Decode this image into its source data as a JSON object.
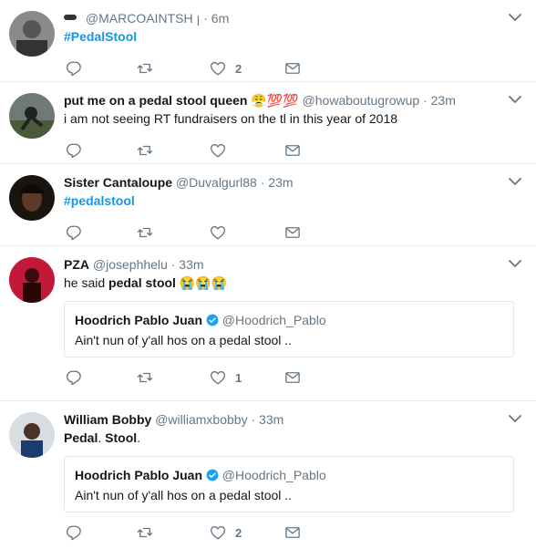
{
  "tweets": [
    {
      "name": "",
      "handle": "@MARCOAINTSH",
      "time": "6m",
      "text_parts": [
        "#PedalStool"
      ],
      "likes": "2",
      "retweets": "",
      "replies": ""
    },
    {
      "name": "put me on a pedal stool queen",
      "name_emoji": "😤💯💯",
      "handle": "@howaboutugrowup",
      "time": "23m",
      "text": "i am not seeing RT fundraisers on the tl in this year of 2018",
      "likes": "",
      "retweets": "",
      "replies": ""
    },
    {
      "name": "Sister Cantaloupe",
      "handle": "@Duvalgurl88",
      "time": "23m",
      "text": "#pedalstool",
      "likes": "",
      "retweets": "",
      "replies": ""
    },
    {
      "name": "PZA",
      "handle": "@josephhelu",
      "time": "33m",
      "text_prefix": "he said ",
      "text_bold": "pedal stool",
      "text_emoji": " 😭😭😭",
      "quote": {
        "name": "Hoodrich Pablo Juan",
        "handle": "@Hoodrich_Pablo",
        "text": "Ain't nun of y'all hos on a pedal stool .."
      },
      "likes": "1",
      "retweets": "",
      "replies": ""
    },
    {
      "name": "William Bobby",
      "handle": "@williamxbobby",
      "time": "33m",
      "text_bold1": "Pedal",
      "text_mid": ". ",
      "text_bold2": "Stool",
      "text_end": ".",
      "quote": {
        "name": "Hoodrich Pablo Juan",
        "handle": "@Hoodrich_Pablo",
        "text": "Ain't nun of y'all hos on a pedal stool .."
      },
      "likes": "2",
      "retweets": "",
      "replies": ""
    }
  ],
  "separator": "·",
  "colors": {
    "hashtag": "#1b95e0",
    "secondary": "#657786",
    "border": "#e6ecf0",
    "verified": "#1da1f2"
  }
}
